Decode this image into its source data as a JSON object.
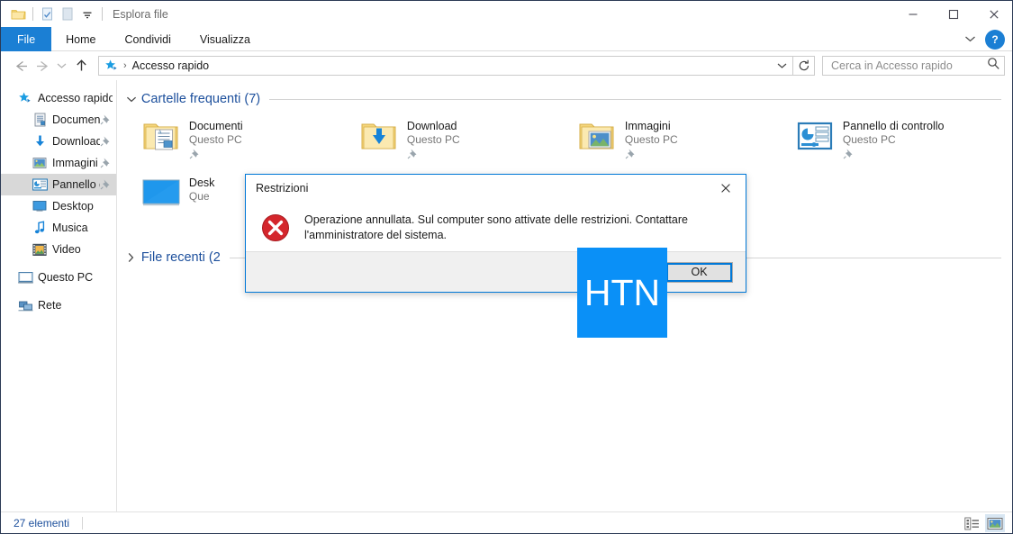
{
  "window": {
    "title": "Esplora file",
    "quick_access_toolbar": [
      {
        "name": "explorer-icon",
        "label": "Esplora file"
      },
      {
        "name": "properties-icon",
        "label": "Proprietà"
      },
      {
        "name": "new-folder-icon",
        "label": "Nuova cartella"
      },
      {
        "name": "customize-qat-dropdown",
        "label": "Personalizza barra di accesso rapido"
      }
    ],
    "controls": {
      "minimize": "—",
      "maximize": "□",
      "close": "✕"
    }
  },
  "ribbon": {
    "tabs": [
      {
        "label": "File",
        "selected": true
      },
      {
        "label": "Home",
        "selected": false
      },
      {
        "label": "Condividi",
        "selected": false
      },
      {
        "label": "Visualizza",
        "selected": false
      }
    ],
    "collapse_label": "⌄",
    "help_label": "?"
  },
  "address": {
    "back": "←",
    "forward": "→",
    "recent": "⌄",
    "up": "↑",
    "path_text": "Accesso rapido",
    "path_separator": "›",
    "dropdown": "⌄",
    "refresh": "↻"
  },
  "search": {
    "placeholder": "Cerca in Accesso rapido",
    "value": ""
  },
  "sidebar": {
    "items": [
      {
        "label": "Accesso rapido",
        "icon": "star-pin-icon",
        "level": 0,
        "selected": false,
        "pinned": false
      },
      {
        "label": "Documenti",
        "icon": "documents-icon",
        "level": 1,
        "selected": false,
        "pinned": true
      },
      {
        "label": "Download",
        "icon": "download-icon",
        "level": 1,
        "selected": false,
        "pinned": true
      },
      {
        "label": "Immagini",
        "icon": "pictures-icon",
        "level": 1,
        "selected": false,
        "pinned": true
      },
      {
        "label": "Pannello di cont",
        "icon": "control-panel-icon",
        "level": 1,
        "selected": true,
        "pinned": true
      },
      {
        "label": "Desktop",
        "icon": "desktop-icon",
        "level": 1,
        "selected": false,
        "pinned": false
      },
      {
        "label": "Musica",
        "icon": "music-icon",
        "level": 1,
        "selected": false,
        "pinned": false
      },
      {
        "label": "Video",
        "icon": "video-icon",
        "level": 1,
        "selected": false,
        "pinned": false
      },
      {
        "label": "Questo PC",
        "icon": "this-pc-icon",
        "level": 0,
        "selected": false,
        "pinned": false
      },
      {
        "label": "Rete",
        "icon": "network-icon",
        "level": 0,
        "selected": false,
        "pinned": false
      }
    ]
  },
  "main": {
    "groups": [
      {
        "title": "Cartelle frequenti (7)",
        "expanded": true,
        "chevron": "⌄"
      },
      {
        "title": "File recenti (2",
        "expanded": false,
        "chevron": "›"
      }
    ],
    "tiles": [
      {
        "name": "Documenti",
        "location": "Questo PC",
        "icon": "folder-documents-icon",
        "pinned": true
      },
      {
        "name": "Download",
        "location": "Questo PC",
        "icon": "folder-download-icon",
        "pinned": true
      },
      {
        "name": "Immagini",
        "location": "Questo PC",
        "icon": "folder-pictures-icon",
        "pinned": true
      },
      {
        "name": "Pannello di controllo",
        "location": "Questo PC",
        "icon": "control-panel-icon",
        "pinned": true
      },
      {
        "name": "Desk",
        "location": "Que",
        "icon": "desktop-thumbnail-icon",
        "pinned": false
      }
    ]
  },
  "dialog": {
    "title": "Restrizioni",
    "close_label": "✕",
    "icon": "error-icon",
    "message": "Operazione annullata. Sul computer sono attivate delle restrizioni. Contattare l'amministratore del sistema.",
    "ok_label": "OK"
  },
  "watermark": {
    "text": "HTN",
    "color": "#0a90f7"
  },
  "statusbar": {
    "item_count": "27 elementi",
    "views": [
      {
        "name": "details-view-button",
        "label": "Dettagli",
        "active": false
      },
      {
        "name": "large-icons-view-button",
        "label": "Icone grandi",
        "active": true
      }
    ]
  },
  "colors": {
    "accent": "#1b7fd4",
    "file_tab": "#1b7fd4",
    "group_title": "#1c4f9c",
    "selection": "#d8d8d8",
    "error_red": "#d13438",
    "watermark_blue": "#0a90f7"
  }
}
